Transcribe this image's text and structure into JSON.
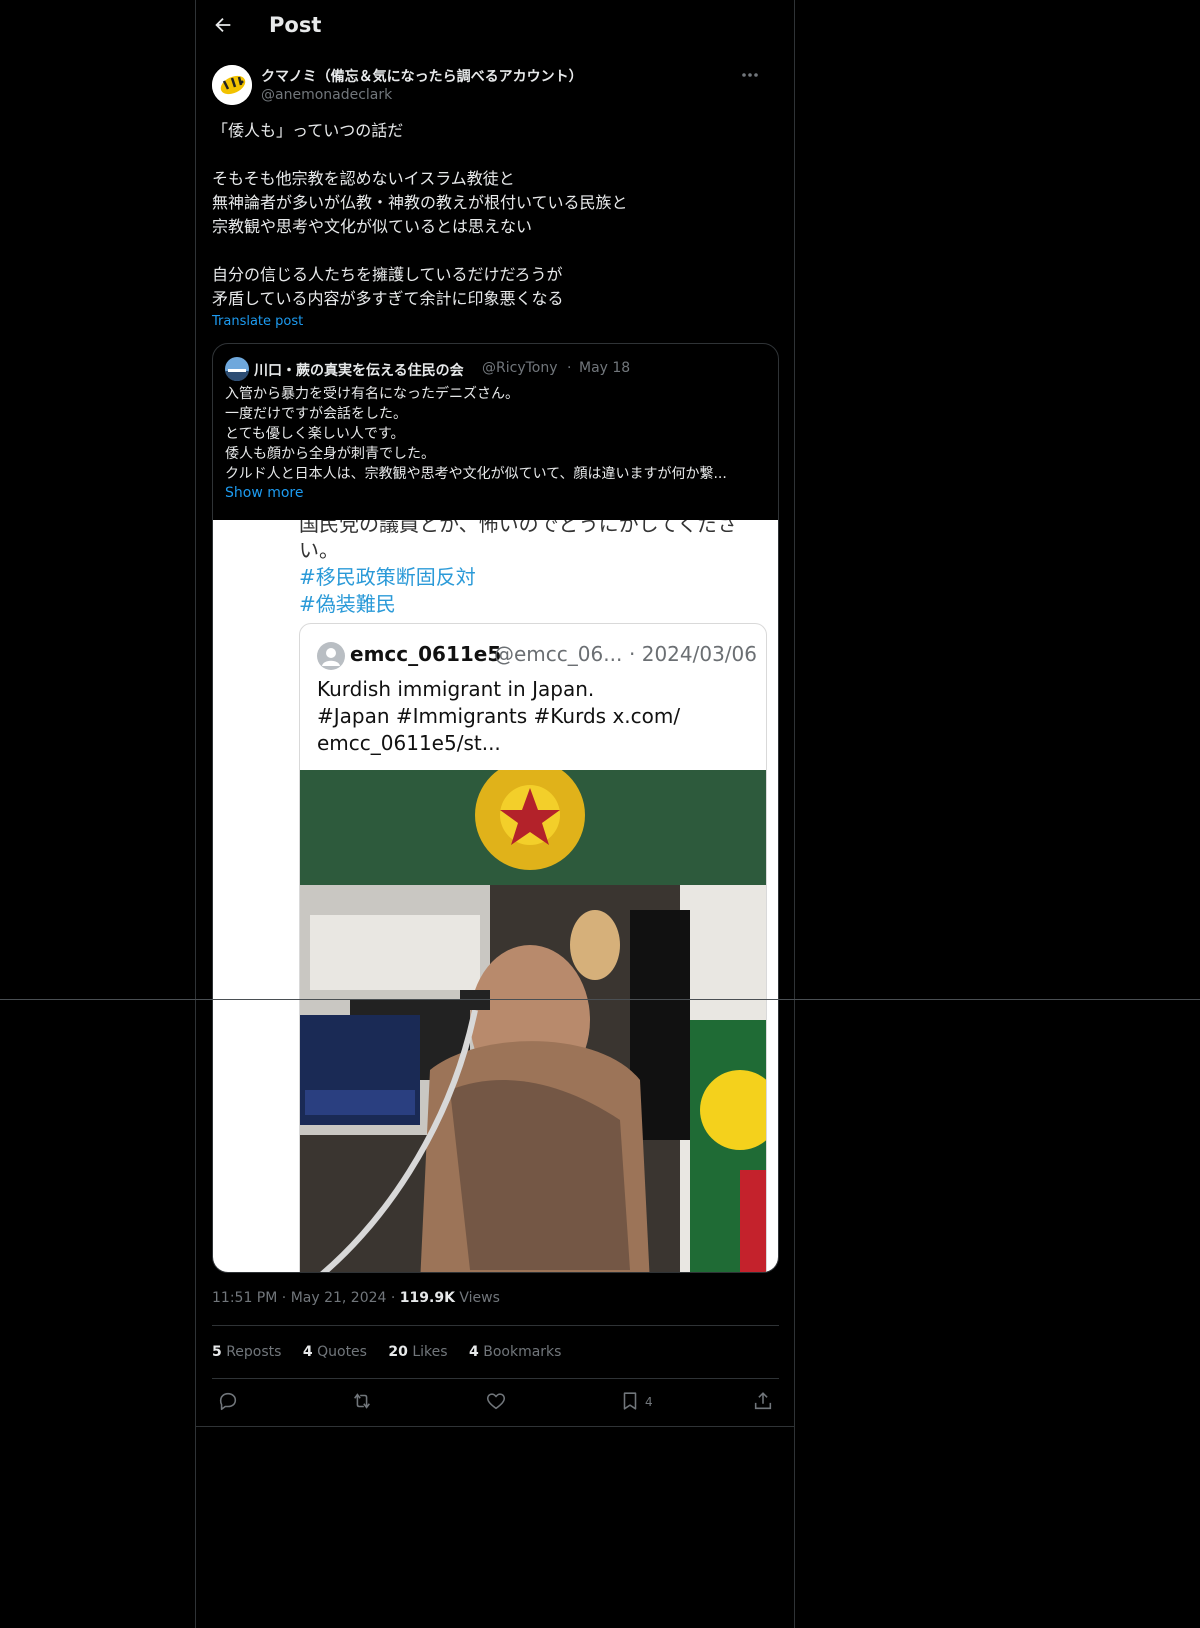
{
  "header": {
    "title": "Post"
  },
  "post": {
    "display_name": "クマノミ（備忘＆気になったら調べるアカウント）",
    "handle": "@anemonadeclark",
    "text_lines": [
      "「倭人も」っていつの話だ",
      "",
      "そもそも他宗教を認めないイスラム教徒と",
      "無神論者が多いが仏教・神教の教えが根付いている民族と",
      "宗教観や思考や文化が似ているとは思えない",
      "",
      "自分の信じる人たちを擁護しているだけだろうが",
      "矛盾している内容が多すぎて余計に印象悪くなる"
    ],
    "translate_label": "Translate post",
    "time": "11:51 PM",
    "date": "May 21, 2024",
    "views_count": "119.9K",
    "views_label": "Views"
  },
  "quote": {
    "display_name": "川口・蕨の真実を伝える住民の会",
    "handle": "@RicyTony",
    "dot": "·",
    "date": "May 18",
    "text_lines": [
      "入管から暴力を受け有名になったデニズさん。",
      "一度だけですが会話をした。",
      "とても優しく楽しい人です。",
      "倭人も顔から全身が刺青でした。",
      "クルド人と日本人は、宗教観や思考や文化が似ていて、顔は違いますが何か繋..."
    ],
    "show_more": "Show more"
  },
  "media": {
    "cut_text": "国民党の議員とか、怖いのでどうにかしてくださ",
    "cut_text2": "い。",
    "tag1": "#移民政策断固反対",
    "tag2": "#偽装難民",
    "card": {
      "name": "emcc_0611e5",
      "handle": "@emcc_06...",
      "date": "· 2024/03/06",
      "text_lines": [
        "Kurdish immigrant in Japan.",
        "#Japan #Immigrants #Kurds x.com/",
        "emcc_0611e5/st..."
      ]
    }
  },
  "stats": {
    "reposts_count": "5",
    "reposts_label": "Reposts",
    "quotes_count": "4",
    "quotes_label": "Quotes",
    "likes_count": "20",
    "likes_label": "Likes",
    "bookmarks_count": "4",
    "bookmarks_label": "Bookmarks"
  },
  "actions": {
    "reply_icon": "reply-icon",
    "repost_icon": "repost-icon",
    "like_icon": "heart-icon",
    "bookmark_icon": "bookmark-icon",
    "bookmark_count": "4",
    "share_icon": "share-icon"
  },
  "colors": {
    "background": "#000000",
    "text": "#e7e9ea",
    "muted": "#71767b",
    "accent": "#1d9bf0",
    "border": "#2f3336"
  }
}
